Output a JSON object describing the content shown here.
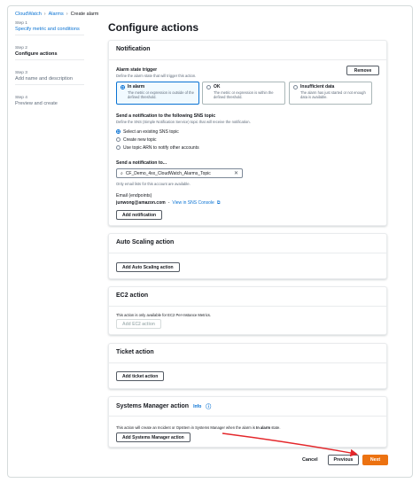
{
  "breadcrumb": [
    "CloudWatch",
    "Alarms",
    "Create alarm"
  ],
  "steps": [
    {
      "label": "Step 1",
      "title": "Specify metric and conditions"
    },
    {
      "label": "Step 2",
      "title": "Configure actions"
    },
    {
      "label": "Step 3",
      "title": "Add name and description"
    },
    {
      "label": "Step 4",
      "title": "Preview and create"
    }
  ],
  "page_title": "Configure actions",
  "notification": {
    "header": "Notification",
    "remove_label": "Remove",
    "trigger_label": "Alarm state trigger",
    "trigger_desc": "Define the alarm state that will trigger this action.",
    "states": [
      {
        "title": "In alarm",
        "desc": "The metric or expression is outside of the defined threshold."
      },
      {
        "title": "OK",
        "desc": "The metric or expression is within the defined threshold."
      },
      {
        "title": "Insufficient data",
        "desc": "The alarm has just started or not enough data is available."
      }
    ],
    "sns_label": "Send a notification to the following SNS topic",
    "sns_desc": "Define the SNS (Simple Notification Service) topic that will receive the notification.",
    "sns_options": [
      "Select an existing SNS topic",
      "Create new topic",
      "Use topic ARN to notify other accounts"
    ],
    "send_to_label": "Send a notification to...",
    "topic_value": "CF_Demo_4xx_CloudWatch_Alarms_Topic",
    "topic_hint": "Only email lists for this account are available.",
    "email_label": "Email (endpoints)",
    "email_value": "junwong@amazon.com",
    "email_sep": "-",
    "console_link": "View in SNS Console",
    "add_label": "Add notification"
  },
  "autoscaling": {
    "header": "Auto Scaling action",
    "add_label": "Add Auto Scaling action"
  },
  "ec2": {
    "header": "EC2 action",
    "desc": "This action is only available for EC2 Per-Instance Metrics.",
    "add_label": "Add EC2 action"
  },
  "ticket": {
    "header": "Ticket action",
    "add_label": "Add ticket action"
  },
  "ssm": {
    "header": "Systems Manager action",
    "info": "Info",
    "desc_pre": "This action will create an Incident or OpsItem in Systems Manager when the alarm is",
    "desc_bold": "In alarm",
    "desc_post": "state.",
    "add_label": "Add Systems Manager action"
  },
  "footer": {
    "cancel": "Cancel",
    "previous": "Previous",
    "next": "Next"
  },
  "colors": {
    "link": "#0972d3",
    "primary": "#ec7211",
    "annotation_arrow": "#e4262a"
  }
}
